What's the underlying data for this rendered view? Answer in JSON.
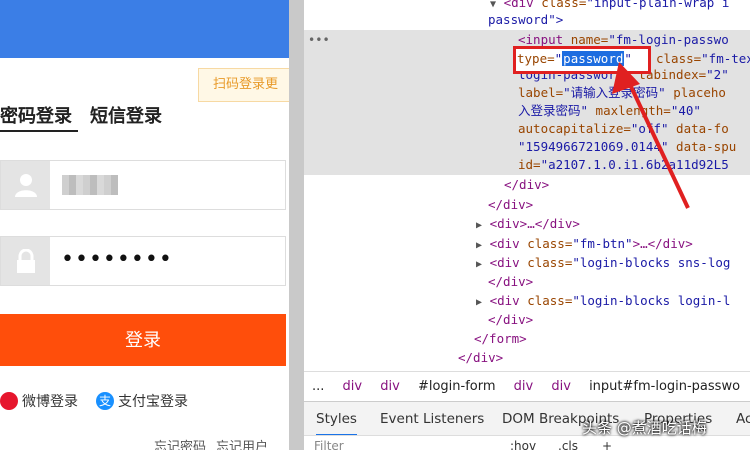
{
  "login": {
    "qr_hint": "扫码登录更",
    "tab_password": "密码登录",
    "tab_sms": "短信登录",
    "password_masked": "••••••••",
    "submit_label": "登录",
    "weibo_label": "微博登录",
    "alipay_label": "支付宝登录",
    "forgot_password": "忘记密码",
    "forgot_username": "忘记用户"
  },
  "devtools": {
    "lines": [
      {
        "pre": "<",
        "tag": "div",
        "attr": " class=",
        "val": "\"input-plain-wrap i"
      },
      {
        "text": "password\">"
      },
      {
        "pre": "<",
        "tag": "input",
        "attr": " name=",
        "val": "\"fm-login-passwo"
      },
      {
        "attr": "class=",
        "val": "\"fm-tex"
      },
      {
        "text": "login-password\"",
        "attr": " tabindex=",
        "val": "\"2\""
      },
      {
        "attr": "label=",
        "val": "\"请输入登录密码\"",
        "attr2": " placeho"
      },
      {
        "val": "入登录密码\"",
        "attr": " maxlength=",
        "val2": "\"40\""
      },
      {
        "attr": "autocapitalize=",
        "val": "\"off\"",
        "attr2": " data-fo"
      },
      {
        "val": "\"1594966721069.0144\"",
        "attr": " data-spu"
      },
      {
        "attr": "id=",
        "val": "\"a2107.1.0.i1.6b2a11d92L5"
      },
      {
        "close": "</div>"
      },
      {
        "close": "</div>"
      },
      {
        "collapsed": "<div>…</div>"
      },
      {
        "tag": "div",
        "attr": " class=",
        "val": "\"fm-btn\"",
        "tail": ">…</div>"
      },
      {
        "tag": "div",
        "attr": " class=",
        "val": "\"login-blocks sns-log"
      },
      {
        "close": "</div>"
      },
      {
        "tag": "div",
        "attr": " class=",
        "val": "\"login-blocks login-l"
      },
      {
        "close": "</div>"
      },
      {
        "close": "</form>"
      },
      {
        "close": "</div>"
      }
    ],
    "highlight_attr": "type=",
    "highlight_value": "password",
    "breadcrumbs": [
      "...",
      "div",
      "div",
      "#login-form",
      "div",
      "div",
      "input#fm-login-passwo"
    ],
    "tabs": [
      "Styles",
      "Event Listeners",
      "DOM Breakpoints",
      "Properties",
      "Ac"
    ],
    "filter_placeholder": "Filter",
    "filter_hov": ":hov",
    "filter_cls": ".cls",
    "filter_plus": "+"
  },
  "watermark": "头条 @煮酒吃话梅",
  "colors": {
    "accent_orange": "#ff4e0b",
    "topband_blue": "#3b7ee6",
    "highlight_red": "#e02020",
    "selection_blue": "#1d6de0"
  }
}
